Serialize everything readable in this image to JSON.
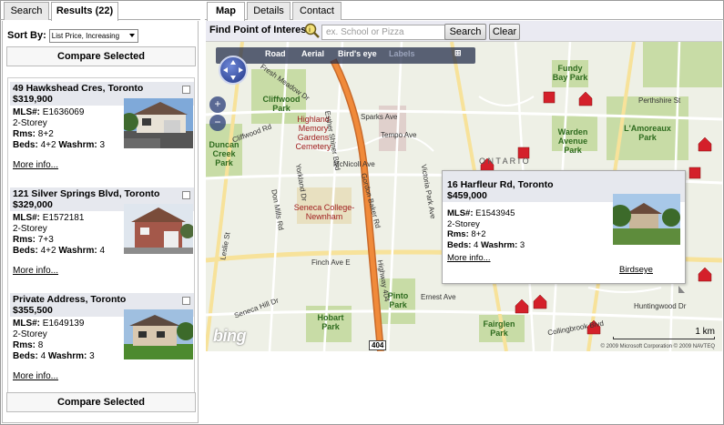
{
  "left": {
    "tabs": [
      "Search",
      "Results (22)"
    ],
    "sort_label": "Sort By:",
    "sort_value": "List Price, Increasing",
    "compare_label": "Compare Selected",
    "more_label": "More info...",
    "listings": [
      {
        "address": "49 Hawkshead Cres, Toronto",
        "price": "$319,900",
        "mls_label": "MLS#:",
        "mls": "E1636069",
        "style": "2-Storey",
        "rms_label": "Rms:",
        "rms": "8+2",
        "beds_label": "Beds:",
        "beds": "4+2",
        "wash_label": "Washrm:",
        "wash": "3"
      },
      {
        "address": "121 Silver Springs Blvd, Toronto",
        "price": "$329,000",
        "mls_label": "MLS#:",
        "mls": "E1572181",
        "style": "2-Storey",
        "rms_label": "Rms:",
        "rms": "7+3",
        "beds_label": "Beds:",
        "beds": "4+2",
        "wash_label": "Washrm:",
        "wash": "4"
      },
      {
        "address": "Private Address, Toronto",
        "price": "$355,500",
        "mls_label": "MLS#:",
        "mls": "E1649139",
        "style": "2-Storey",
        "rms_label": "Rms:",
        "rms": "8",
        "beds_label": "Beds:",
        "beds": "4",
        "wash_label": "Washrm:",
        "wash": "3"
      }
    ]
  },
  "right": {
    "tabs": [
      "Map",
      "Details",
      "Contact"
    ],
    "poi_label": "Find Point of Interest:",
    "poi_placeholder": "ex. School or Pizza",
    "search_btn": "Search",
    "clear_btn": "Clear",
    "map_nav": [
      "Road",
      "Aerial",
      "Bird's eye",
      "Labels"
    ],
    "zoom_in": "+",
    "zoom_out": "−",
    "popup": {
      "address": "16 Harfleur Rd, Toronto",
      "price": "$459,000",
      "mls_label": "MLS#:",
      "mls": "E1543945",
      "style": "2-Storey",
      "rms_label": "Rms:",
      "rms": "8+2",
      "beds_label": "Beds:",
      "beds": "4",
      "wash_label": "Washrm:",
      "wash": "3",
      "more": "More info...",
      "birdseye": "Birdseye"
    },
    "scale": "1 km",
    "copyright": "© 2009 Microsoft Corporation   © 2009 NAVTEQ",
    "brand": "bing",
    "highway": "404",
    "parks": [
      "Cliffwood Park",
      "Duncan Creek Park",
      "Fundy Bay Park",
      "Warden Avenue Park",
      "L'Amoreaux Park",
      "Pinto Park",
      "Hobart Park",
      "Fairglen Park"
    ],
    "cemetery": "Highland Memory Gardens Cemetery",
    "college": "Seneca College-Newnham",
    "province": "O N T A R I O",
    "streets": [
      "Fresh Meadow Dr",
      "Sparks Ave",
      "Tempo Ave",
      "McNicoll Ave",
      "Cliffwood Rd",
      "Finch Ave E",
      "Seneca Hill Dr",
      "Ernest Ave",
      "Collingbrook Blvd",
      "Huntingwood Dr",
      "Perthshire St",
      "Victoria Park Ave",
      "Don Mills Rd",
      "Leslie St",
      "Gordon Baker Rd",
      "Yorkland Dr",
      "Highway 404",
      "Esther Shiner Blvd"
    ]
  }
}
